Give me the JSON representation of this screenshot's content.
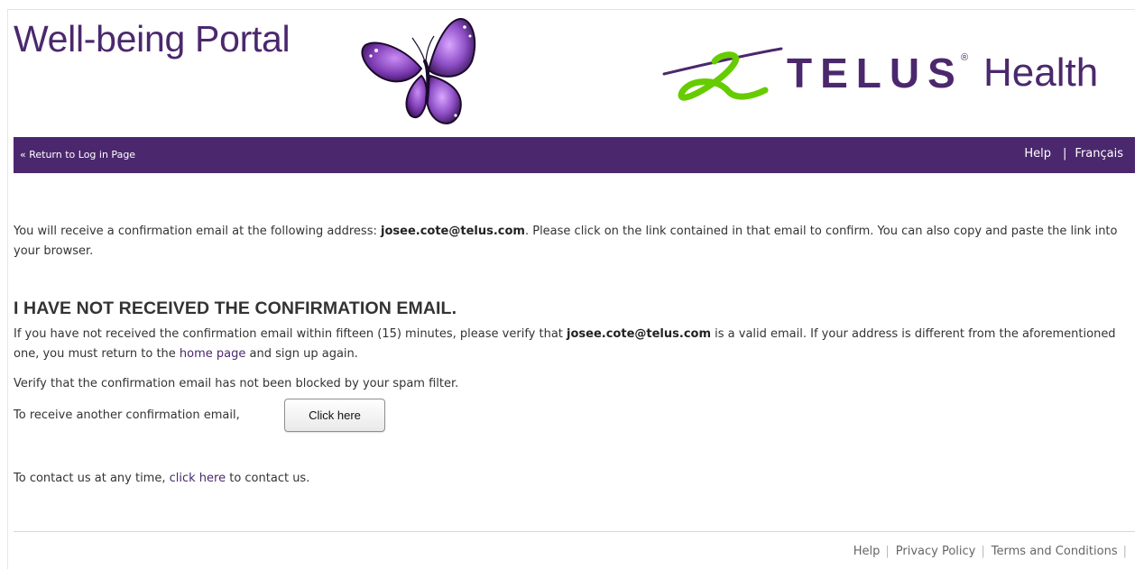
{
  "header": {
    "portal_title": "Well-being Portal",
    "brand_word": "TELUS",
    "brand_reg": "®",
    "brand_suffix": "Health"
  },
  "nav": {
    "return_label": "« Return to Log in Page",
    "help_label": "Help",
    "separator": "|",
    "language_label": "Français"
  },
  "content": {
    "intro_before": "You will receive a confirmation email at the following address: ",
    "email": "josee.cote@telus.com",
    "intro_after": ". Please click on the link contained in that email to confirm. You can also copy and paste the link into your browser.",
    "heading": "I HAVE NOT RECEIVED THE CONFIRMATION EMAIL.",
    "verify_before": "If you have not received the confirmation email within fifteen (15) minutes, please verify that ",
    "verify_after": " is a valid email. If your address is different from the aforementioned one, you must return to the ",
    "home_link": "home page",
    "verify_end": " and sign up again.",
    "spam_text": "Verify that the confirmation email has not been blocked by your spam filter.",
    "resend_text": "To receive another confirmation email,",
    "resend_button": "Click here",
    "contact_before": "To contact us at any time, ",
    "contact_link": "click here",
    "contact_after": " to contact us."
  },
  "footer": {
    "help": "Help",
    "privacy": "Privacy Policy",
    "terms": "Terms and Conditions",
    "separator": "|"
  },
  "colors": {
    "brand_purple": "#4b286d",
    "brand_green": "#66cc00",
    "butterfly_purple": "#8e4ec6"
  }
}
